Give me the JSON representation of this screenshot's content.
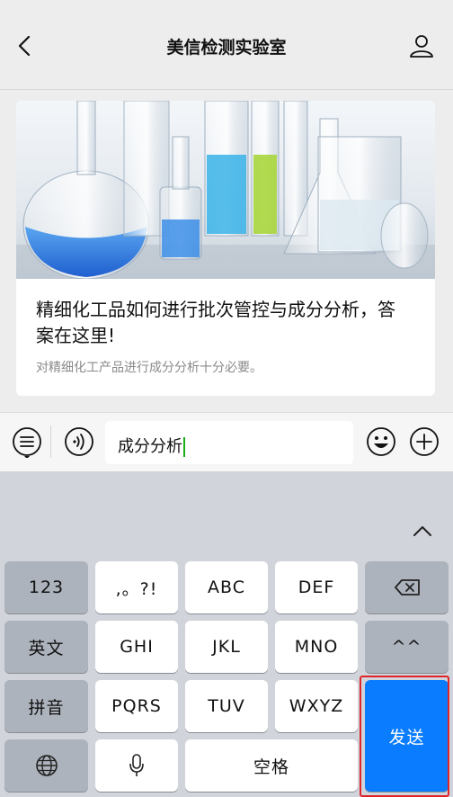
{
  "nav": {
    "title": "美信检测实验室",
    "back_icon": "back-arrow-icon",
    "user_icon": "user-icon"
  },
  "article": {
    "title": "精细化工品如何进行批次管控与成分分析，答案在这里!",
    "description": "对精细化工产品进行成分分析十分必要。"
  },
  "input": {
    "value": "成分分析"
  },
  "keyboard": {
    "row1": [
      "123",
      ",。?!",
      "ABC",
      "DEF"
    ],
    "row2": [
      "英文",
      "GHI",
      "JKL",
      "MNO",
      "^^"
    ],
    "row3": [
      "拼音",
      "PQRS",
      "TUV",
      "WXYZ"
    ],
    "row4": [
      "空格"
    ],
    "send": "发送"
  },
  "colors": {
    "send": "#0a7cff",
    "highlight": "#e0252a",
    "caret": "#1aad19"
  }
}
